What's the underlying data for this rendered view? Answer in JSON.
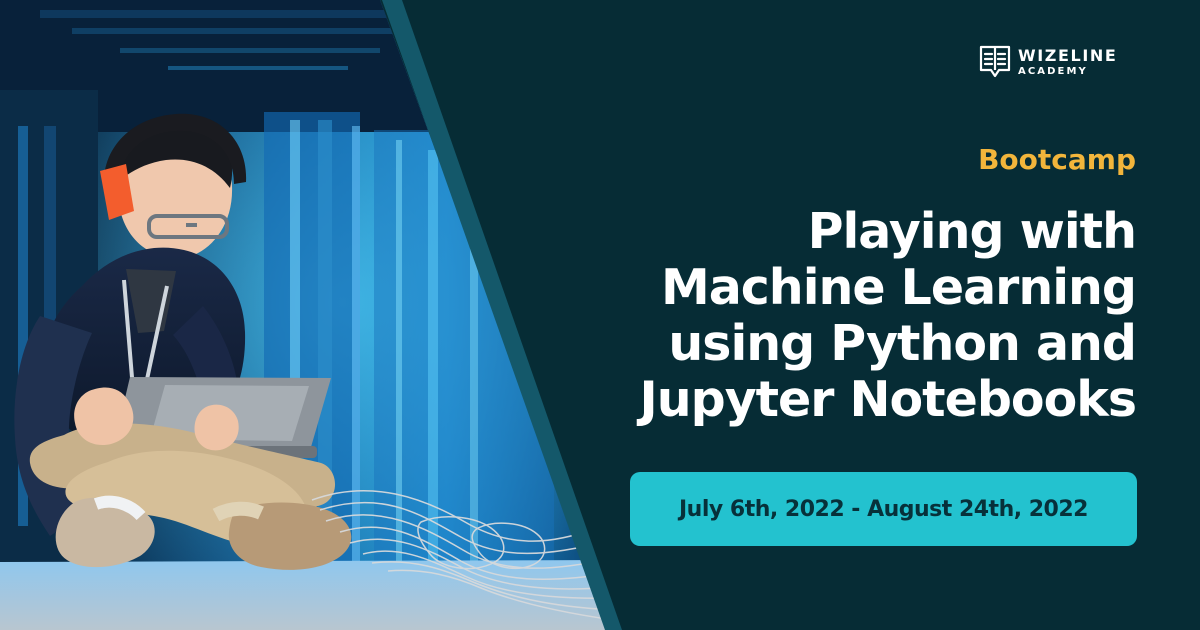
{
  "brand": {
    "name_line1": "WIZELINE",
    "name_line2": "ACADEMY",
    "logo_icon": "book-chat-icon"
  },
  "hero": {
    "eyebrow": "Bootcamp",
    "title_lines": [
      "Playing with",
      "Machine Learning",
      "using Python and",
      "Jupyter Notebooks"
    ],
    "date_range": "July 6th, 2022 - August 24th, 2022"
  },
  "colors": {
    "background": "#062c35",
    "accent_orange": "#f2b53b",
    "accent_teal": "#23c2cf",
    "text_white": "#ffffff",
    "date_text": "#07313a"
  },
  "image": {
    "scene": "person-with-headphones-using-laptop-in-server-room"
  }
}
